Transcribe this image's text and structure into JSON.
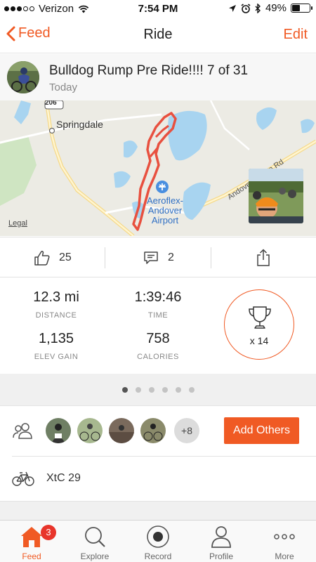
{
  "status_bar": {
    "carrier": "Verizon",
    "time": "7:54 PM",
    "battery_percent": "49%",
    "battery_level": 0.49
  },
  "nav": {
    "back_label": "Feed",
    "title": "Ride",
    "edit_label": "Edit"
  },
  "activity": {
    "title": "Bulldog Rump Pre Ride!!!! 7 of 31",
    "date": "Today"
  },
  "map": {
    "town_label": "Springdale",
    "route_shield": "206",
    "airport_label_line1": "Aeroflex-",
    "airport_label_line2": "Andover",
    "airport_label_line3": "Airport",
    "road_label": "Andover Sparta Rd",
    "legal_label": "Legal",
    "route_color": "#e8503f"
  },
  "actions": {
    "kudos_count": "25",
    "comment_count": "2"
  },
  "stats": {
    "distance_value": "12.3 mi",
    "distance_label": "DISTANCE",
    "time_value": "1:39:46",
    "time_label": "TIME",
    "elev_value": "1,135",
    "elev_label": "ELEV GAIN",
    "calories_value": "758",
    "calories_label": "CALORIES",
    "achievements_label": "x 14"
  },
  "pagination": {
    "total": 6,
    "active_index": 0
  },
  "athletes": {
    "more_label": "+8",
    "add_others_label": "Add Others"
  },
  "gear": {
    "name": "XtC 29"
  },
  "tabs": [
    {
      "label": "Feed",
      "badge": "3",
      "active": true
    },
    {
      "label": "Explore"
    },
    {
      "label": "Record"
    },
    {
      "label": "Profile"
    },
    {
      "label": "More"
    }
  ],
  "colors": {
    "accent": "#f05a24",
    "badge": "#e8352b",
    "water": "#a8d4f0",
    "forest": "#cfe5c2"
  }
}
